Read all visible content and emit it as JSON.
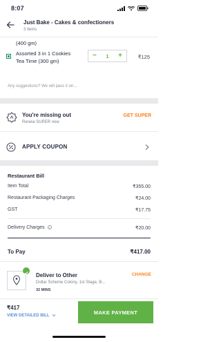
{
  "status_bar": {
    "time": "8:07"
  },
  "header": {
    "restaurant_name": "Just Bake - Cakes & confectioners",
    "item_count": "3 items"
  },
  "cart": {
    "previous_item_weight": "(400 gm)",
    "item": {
      "name_line1": "Assorted 3 in 1 Cookies",
      "name_line2": "Tea Time (300 gm)",
      "quantity": "1",
      "decrement": "−",
      "increment": "+",
      "price": "₹125"
    },
    "suggestions_placeholder": "Any suggestions? We will pass it on..."
  },
  "super": {
    "title": "You're missing out",
    "subtitle": "Renew SUPER now",
    "action": "GET SUPER"
  },
  "coupon": {
    "label": "APPLY COUPON"
  },
  "bill": {
    "title": "Restaurant Bill",
    "lines": [
      {
        "label": "Item Total",
        "value": "₹355.00"
      },
      {
        "label": "Restaurant Packaging Charges",
        "value": "₹24.00"
      },
      {
        "label": "GST",
        "value": "₹17.75"
      }
    ],
    "delivery": {
      "label": "Delivery Charges",
      "value": "₹20.00"
    },
    "to_pay": {
      "label": "To Pay",
      "value": "₹417.00"
    }
  },
  "address": {
    "title": "Deliver to Other",
    "change": "CHANGE",
    "line": "Dollar Scheme Colony, 1st Stage, B...",
    "eta": "32 MINS"
  },
  "footer": {
    "total": "₹417",
    "view_bill": "VIEW DETAILED BILL",
    "pay_button": "MAKE PAYMENT"
  },
  "colors": {
    "accent": "#fc8019",
    "green": "#60b246",
    "link": "#5d8ed5"
  }
}
